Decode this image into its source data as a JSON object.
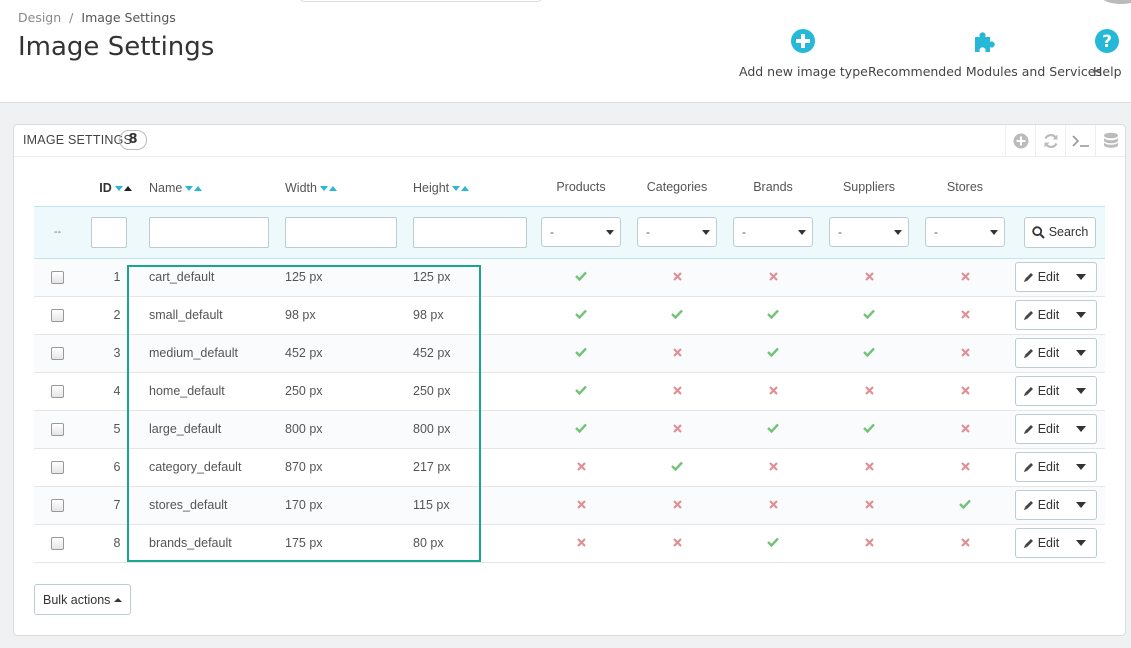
{
  "breadcrumb": {
    "parent": "Design",
    "separator": "/",
    "current": "Image Settings"
  },
  "page_title": "Image Settings",
  "toolbar": {
    "add_label": "Add new image type",
    "modules_label": "Recommended Modules and Services",
    "help_label": "Help",
    "icon_color": "#25b9d7"
  },
  "panel": {
    "title": "IMAGE SETTINGS",
    "count": "8"
  },
  "columns": {
    "id": "ID",
    "name": "Name",
    "width": "Width",
    "height": "Height",
    "products": "Products",
    "categories": "Categories",
    "brands": "Brands",
    "suppliers": "Suppliers",
    "stores": "Stores"
  },
  "filter": {
    "id_placeholder": "--",
    "select_value": "-",
    "search_label": "Search"
  },
  "edit_label": "Edit",
  "bulk_label": "Bulk actions",
  "status_colors": {
    "yes": "#72c279",
    "no": "#e08f95"
  },
  "rows": [
    {
      "id": "1",
      "name": "cart_default",
      "width": "125 px",
      "height": "125 px",
      "products": "yes",
      "categories": "no",
      "brands": "no",
      "suppliers": "no",
      "stores": "no"
    },
    {
      "id": "2",
      "name": "small_default",
      "width": "98 px",
      "height": "98 px",
      "products": "yes",
      "categories": "yes",
      "brands": "yes",
      "suppliers": "yes",
      "stores": "no"
    },
    {
      "id": "3",
      "name": "medium_default",
      "width": "452 px",
      "height": "452 px",
      "products": "yes",
      "categories": "no",
      "brands": "yes",
      "suppliers": "yes",
      "stores": "no"
    },
    {
      "id": "4",
      "name": "home_default",
      "width": "250 px",
      "height": "250 px",
      "products": "yes",
      "categories": "no",
      "brands": "no",
      "suppliers": "no",
      "stores": "no"
    },
    {
      "id": "5",
      "name": "large_default",
      "width": "800 px",
      "height": "800 px",
      "products": "yes",
      "categories": "no",
      "brands": "yes",
      "suppliers": "yes",
      "stores": "no"
    },
    {
      "id": "6",
      "name": "category_default",
      "width": "870 px",
      "height": "217 px",
      "products": "no",
      "categories": "yes",
      "brands": "no",
      "suppliers": "no",
      "stores": "no"
    },
    {
      "id": "7",
      "name": "stores_default",
      "width": "170 px",
      "height": "115 px",
      "products": "no",
      "categories": "no",
      "brands": "no",
      "suppliers": "no",
      "stores": "yes"
    },
    {
      "id": "8",
      "name": "brands_default",
      "width": "175 px",
      "height": "80 px",
      "products": "no",
      "categories": "no",
      "brands": "yes",
      "suppliers": "no",
      "stores": "no"
    }
  ]
}
